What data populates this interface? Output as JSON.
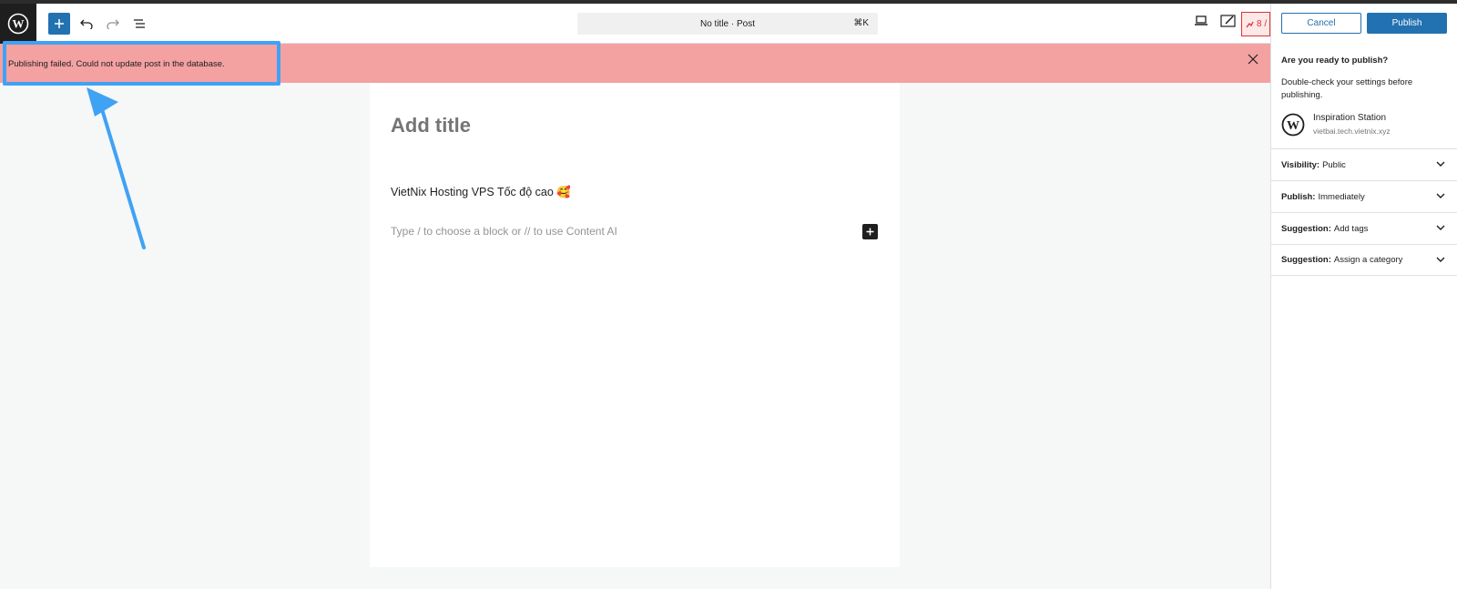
{
  "toolbar": {
    "document_title": "No title · Post",
    "shortcut": "⌘K",
    "rank_badge": "8 /"
  },
  "notice": {
    "message": "Publishing failed. Could not update post in the database."
  },
  "editor": {
    "title_placeholder": "Add title",
    "paragraph": "VietNix Hosting VPS Tốc độ cao 🥰",
    "block_placeholder": "Type / to choose a block or // to use Content AI"
  },
  "sidebar": {
    "cancel_label": "Cancel",
    "publish_label": "Publish",
    "heading": "Are you ready to publish?",
    "description": "Double-check your settings before publishing.",
    "site_name": "Inspiration Station",
    "site_url": "vietbai.tech.vietnix.xyz",
    "rows": [
      {
        "label": "Visibility:",
        "value": "Public"
      },
      {
        "label": "Publish:",
        "value": "Immediately"
      },
      {
        "label": "Suggestion:",
        "value": "Add tags"
      },
      {
        "label": "Suggestion:",
        "value": "Assign a category"
      }
    ]
  },
  "colors": {
    "accent": "#2271b1",
    "notice_bg": "#f4a1a1",
    "highlight": "#3fa2f4"
  },
  "icons": [
    "wordpress-logo-icon",
    "plus-icon",
    "undo-icon",
    "redo-icon",
    "list-view-icon",
    "desktop-preview-icon",
    "edit-icon",
    "close-icon",
    "chevron-down-icon",
    "arrow-annotation-icon"
  ]
}
